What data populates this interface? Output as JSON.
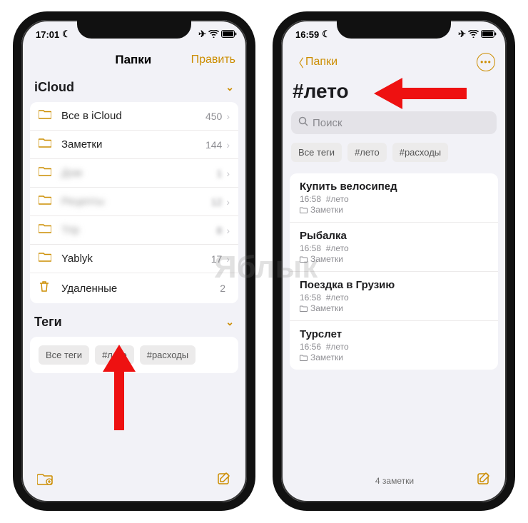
{
  "watermark": "Яблык",
  "left": {
    "status_time": "17:01",
    "nav_title": "Папки",
    "nav_edit": "Править",
    "icloud_header": "iCloud",
    "folders": [
      {
        "icon": "folder",
        "label": "Все в iCloud",
        "count": "450",
        "blurred": false
      },
      {
        "icon": "folder",
        "label": "Заметки",
        "count": "144",
        "blurred": false
      },
      {
        "icon": "folder",
        "label": "Дом",
        "count": "1",
        "blurred": true
      },
      {
        "icon": "folder",
        "label": "Рецепты",
        "count": "12",
        "blurred": true
      },
      {
        "icon": "folder",
        "label": "Trip",
        "count": "8",
        "blurred": true
      },
      {
        "icon": "folder",
        "label": "Yablyk",
        "count": "17",
        "blurred": false
      },
      {
        "icon": "trash",
        "label": "Удаленные",
        "count": "2",
        "blurred": false
      }
    ],
    "tags_header": "Теги",
    "tags": [
      "Все теги",
      "#лето",
      "#расходы"
    ]
  },
  "right": {
    "status_time": "16:59",
    "back_label": "Папки",
    "title": "#лето",
    "search_placeholder": "Поиск",
    "tags": [
      "Все теги",
      "#лето",
      "#расходы"
    ],
    "notes": [
      {
        "title": "Купить велосипед",
        "time": "16:58",
        "tag": "#лето",
        "folder": "Заметки"
      },
      {
        "title": "Рыбалка",
        "time": "16:58",
        "tag": "#лето",
        "folder": "Заметки"
      },
      {
        "title": "Поездка в Грузию",
        "time": "16:58",
        "tag": "#лето",
        "folder": "Заметки"
      },
      {
        "title": "Турслет",
        "time": "16:56",
        "tag": "#лето",
        "folder": "Заметки"
      }
    ],
    "footer_count": "4 заметки"
  }
}
